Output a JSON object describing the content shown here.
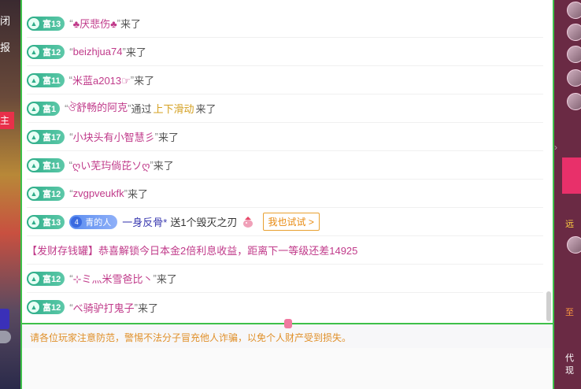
{
  "left_strip": {
    "fragments": [
      "闭",
      "报",
      "主"
    ]
  },
  "chat": {
    "messages": [
      {
        "type": "enter",
        "level": "富13",
        "nick": "♣厌悲伤♣",
        "suffix": "来了"
      },
      {
        "type": "enter",
        "level": "富12",
        "nick": "beizhjua74",
        "suffix": "来了"
      },
      {
        "type": "enter",
        "level": "富11",
        "nick": "米蓝a2013☞",
        "suffix": "来了"
      },
      {
        "type": "enter_via",
        "level": "富1",
        "nick": "ঔ舒畅的阿克",
        "via_prefix": "通过",
        "via_highlight": "上下滑动",
        "suffix": "来了"
      },
      {
        "type": "enter",
        "level": "富17",
        "nick": "小块头有小智慧彡",
        "suffix": "来了"
      },
      {
        "type": "enter",
        "level": "富11",
        "nick": "ღい芜玙倘芘ソღ",
        "suffix": "来了"
      },
      {
        "type": "enter",
        "level": "富12",
        "nick": "zvgpveukfk",
        "suffix": "来了"
      },
      {
        "type": "gift",
        "level": "富13",
        "fan_level": "4",
        "fan_name": "青的人",
        "nick": "一身反骨*",
        "gift_text": "送1个毁灭之刃",
        "try_label": "我也试试 >"
      },
      {
        "type": "system",
        "text": "【发财存钱罐】恭喜解锁今日本金2倍利息收益，距离下一等级还差14925"
      },
      {
        "type": "enter",
        "level": "富12",
        "nick": "⊹ミ灬米雪爸比丶",
        "suffix": "来了"
      },
      {
        "type": "enter",
        "level": "富12",
        "nick": "べ骑驴打鬼子",
        "suffix": "来了"
      }
    ],
    "notice": "请各位玩家注意防范，警惕不法分子冒充他人诈骗，以免个人财产受到损失。"
  },
  "right_strip": {
    "labels": [
      "远",
      "至",
      "代现"
    ]
  },
  "colors": {
    "accent_green": "#3ec04a",
    "nick_pink": "#c03a8a",
    "highlight_gold": "#d4a020",
    "notice_orange": "#e0902a",
    "level_badge": "#2fae8a"
  }
}
